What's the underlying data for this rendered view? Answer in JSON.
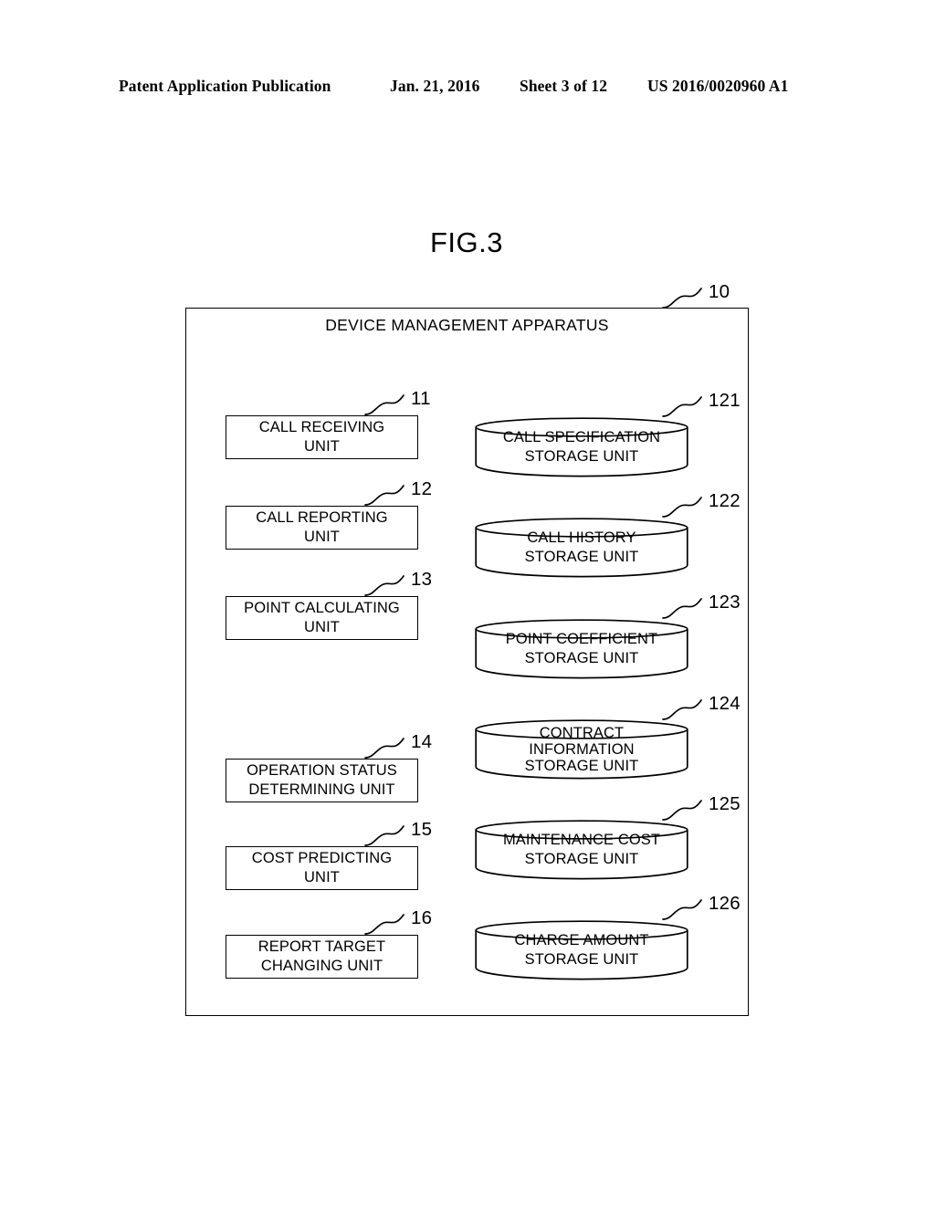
{
  "page_header": {
    "publication": "Patent Application Publication",
    "date": "Jan. 21, 2016",
    "sheet": "Sheet 3 of 12",
    "patent_number": "US 2016/0020960 A1"
  },
  "figure": {
    "title": "FIG.3",
    "apparatus_title": "DEVICE MANAGEMENT APPARATUS",
    "apparatus_ref": "10"
  },
  "processing_units": [
    {
      "ref": "11",
      "label": "CALL RECEIVING\nUNIT"
    },
    {
      "ref": "12",
      "label": "CALL REPORTING\nUNIT"
    },
    {
      "ref": "13",
      "label": "POINT CALCULATING\nUNIT"
    },
    {
      "ref": "14",
      "label": "OPERATION STATUS\nDETERMINING UNIT"
    },
    {
      "ref": "15",
      "label": "COST PREDICTING\nUNIT"
    },
    {
      "ref": "16",
      "label": "REPORT TARGET\nCHANGING UNIT"
    }
  ],
  "storage_units": [
    {
      "ref": "121",
      "label": "CALL SPECIFICATION\nSTORAGE UNIT"
    },
    {
      "ref": "122",
      "label": "CALL HISTORY\nSTORAGE UNIT"
    },
    {
      "ref": "123",
      "label": "POINT COEFFICIENT\nSTORAGE UNIT"
    },
    {
      "ref": "124",
      "label": "CONTRACT\nINFORMATION\nSTORAGE UNIT"
    },
    {
      "ref": "125",
      "label": "MAINTENANCE COST\nSTORAGE UNIT"
    },
    {
      "ref": "126",
      "label": "CHARGE AMOUNT\nSTORAGE UNIT"
    }
  ],
  "colors": {
    "ink": "#000000",
    "paper": "#ffffff"
  }
}
